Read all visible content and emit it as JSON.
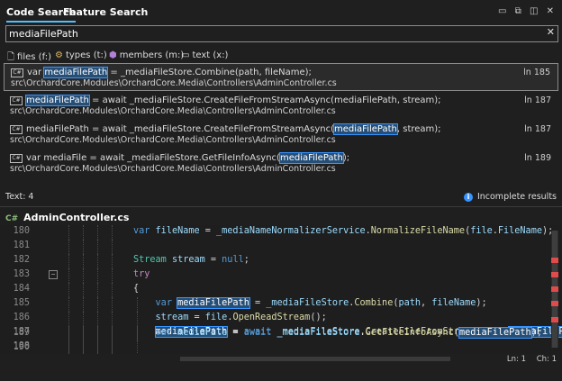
{
  "tabs": [
    {
      "label": "Code Search"
    },
    {
      "label": "Feature Search"
    }
  ],
  "window_controls": "▭ ⧉ ◫ ✕",
  "search": {
    "value": "mediaFilePath",
    "clear": "✕"
  },
  "filters": [
    {
      "label": "files (f:)",
      "icon": "file-icon"
    },
    {
      "label": "types (t:)",
      "icon": "types-icon"
    },
    {
      "label": "members (m:)",
      "icon": "members-icon"
    },
    {
      "label": "text (x:)",
      "icon": "text-icon"
    }
  ],
  "results": [
    {
      "pre": "var ",
      "match": "mediaFilePath",
      "post": " = _mediaFileStore.Combine(path, fileName);",
      "path": "src\\OrchardCore.Modules\\OrchardCore.Media\\Controllers\\AdminController.cs",
      "line": "ln 185"
    },
    {
      "pre": "",
      "match": "mediaFilePath",
      "post": " = await _mediaFileStore.CreateFileFromStreamAsync(mediaFilePath, stream);",
      "path": "src\\OrchardCore.Modules\\OrchardCore.Media\\Controllers\\AdminController.cs",
      "line": "ln 187"
    },
    {
      "pre": "mediaFilePath = await _mediaFileStore.CreateFileFromStreamAsync(",
      "match": "mediaFilePath",
      "post": ", stream);",
      "path": "src\\OrchardCore.Modules\\OrchardCore.Media\\Controllers\\AdminController.cs",
      "line": "ln 187"
    },
    {
      "pre": "var mediaFile = await _mediaFileStore.GetFileInfoAsync(",
      "match": "mediaFilePath",
      "post": ");",
      "path": "src\\OrchardCore.Modules\\OrchardCore.Media\\Controllers\\AdminController.cs",
      "line": "ln 189"
    }
  ],
  "result_count": "Text: 4",
  "incomplete_label": "Incomplete results",
  "file_header": {
    "icon": "C#",
    "name": "AdminController.cs"
  },
  "code_lines": [
    {
      "num": "180",
      "code": "var fileName = _mediaNameNormalizerService.NormalizeFileName(file.FileName);"
    },
    {
      "num": "181",
      "code": ""
    },
    {
      "num": "182",
      "code": "Stream stream = null;"
    },
    {
      "num": "183",
      "code": "try"
    },
    {
      "num": "184",
      "code": "{"
    },
    {
      "num": "185",
      "code": "    var mediaFilePath = _mediaFileStore.Combine(path, fileName);"
    },
    {
      "num": "186",
      "code": "    stream = file.OpenReadStream();"
    },
    {
      "num": "187",
      "code": "    mediaFilePath = await _mediaFileStore.CreateFileFromStreamAsync(mediaFilePath,"
    },
    {
      "num": "188",
      "code": ""
    },
    {
      "num": "189",
      "code": "    var mediaFile = await _mediaFileStore.GetFileInfoAsync(mediaFilePath);"
    },
    {
      "num": "190",
      "code": ""
    }
  ],
  "status": {
    "line": "Ln: 1",
    "char": "Ch: 1"
  }
}
